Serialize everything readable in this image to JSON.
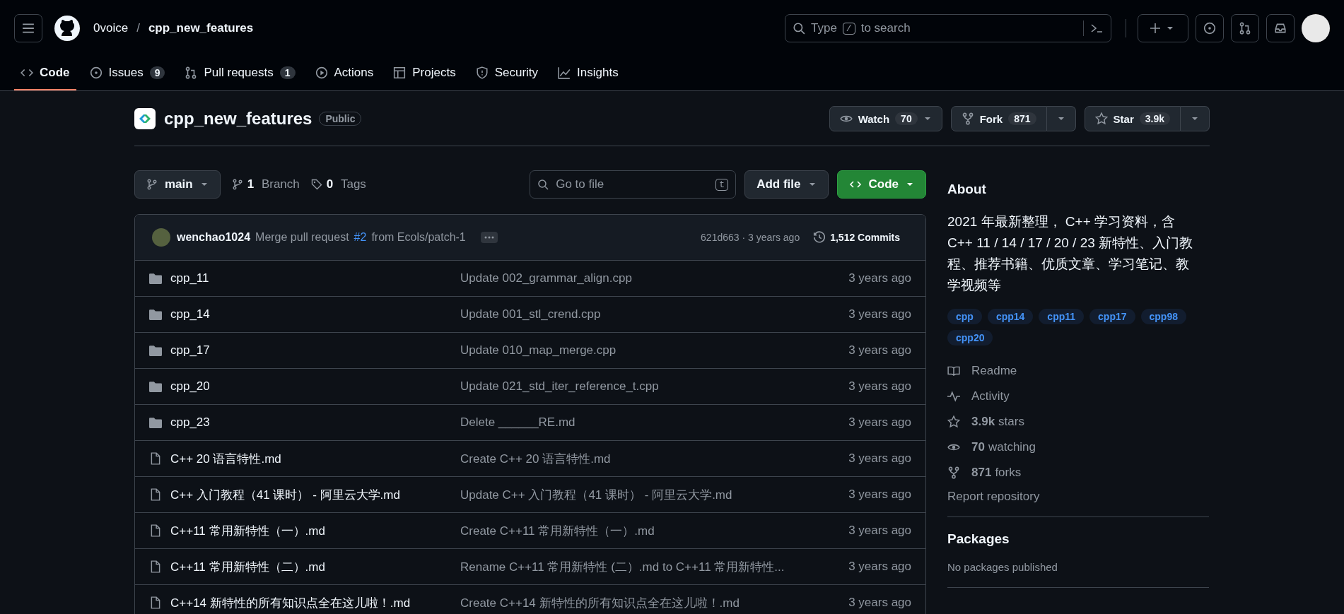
{
  "header": {
    "owner": "0voice",
    "separator": "/",
    "repo": "cpp_new_features",
    "search_placeholder_before": "Type",
    "search_key": "/",
    "search_placeholder_after": "to search"
  },
  "tabs": [
    {
      "label": "Code",
      "kind": "code",
      "selected": true
    },
    {
      "label": "Issues",
      "kind": "issue",
      "counter": "9",
      "selected": false
    },
    {
      "label": "Pull requests",
      "kind": "pr",
      "counter": "1",
      "selected": false
    },
    {
      "label": "Actions",
      "kind": "play",
      "selected": false
    },
    {
      "label": "Projects",
      "kind": "table",
      "selected": false
    },
    {
      "label": "Security",
      "kind": "shield",
      "selected": false
    },
    {
      "label": "Insights",
      "kind": "graph",
      "selected": false
    }
  ],
  "repo": {
    "name": "cpp_new_features",
    "visibility": "Public",
    "watch": {
      "label": "Watch",
      "count": "70"
    },
    "fork": {
      "label": "Fork",
      "count": "871"
    },
    "star": {
      "label": "Star",
      "count": "3.9k"
    }
  },
  "toolbar": {
    "branch": "main",
    "branches_count": "1",
    "branches_label": "Branch",
    "tags_count": "0",
    "tags_label": "Tags",
    "goto_placeholder": "Go to file",
    "goto_key": "t",
    "add_file": "Add file",
    "code": "Code"
  },
  "latest_commit": {
    "author": "wenchao1024",
    "message_before": "Merge pull request",
    "pr_link": "#2",
    "message_after": "from Ecols/patch-1",
    "meta": "621d663 · 3 years ago",
    "commits": "1,512 Commits"
  },
  "files": [
    {
      "kind": "folder",
      "name": "cpp_11",
      "message": "Update 002_grammar_align.cpp",
      "age": "3 years ago"
    },
    {
      "kind": "folder",
      "name": "cpp_14",
      "message": "Update 001_stl_crend.cpp",
      "age": "3 years ago"
    },
    {
      "kind": "folder",
      "name": "cpp_17",
      "message": "Update 010_map_merge.cpp",
      "age": "3 years ago"
    },
    {
      "kind": "folder",
      "name": "cpp_20",
      "message": "Update 021_std_iter_reference_t.cpp",
      "age": "3 years ago"
    },
    {
      "kind": "folder",
      "name": "cpp_23",
      "message": "Delete ______RE.md",
      "age": "3 years ago"
    },
    {
      "kind": "file",
      "name": "C++ 20 语言特性.md",
      "message": "Create C++ 20 语言特性.md",
      "age": "3 years ago"
    },
    {
      "kind": "file",
      "name": "C++ 入门教程（41 课时） - 阿里云大学.md",
      "message": "Update C++ 入门教程（41 课时） - 阿里云大学.md",
      "age": "3 years ago"
    },
    {
      "kind": "file",
      "name": "C++11 常用新特性（一）.md",
      "message": "Create C++11 常用新特性（一）.md",
      "age": "3 years ago"
    },
    {
      "kind": "file",
      "name": "C++11 常用新特性（二）.md",
      "message": "Rename C++11 常用新特性 (二）.md to C++11 常用新特性...",
      "age": "3 years ago"
    },
    {
      "kind": "file",
      "name": "C++14 新特性的所有知识点全在这儿啦！.md",
      "message": "Create C++14 新特性的所有知识点全在这儿啦！.md",
      "age": "3 years ago"
    }
  ],
  "about": {
    "title": "About",
    "description": "2021 年最新整理， C++ 学习资料，含 C++ 11 / 14 / 17 / 20 / 23 新特性、入门教程、推荐书籍、优质文章、学习笔记、教学视频等",
    "topics": [
      "cpp",
      "cpp14",
      "cpp11",
      "cpp17",
      "cpp98",
      "cpp20"
    ],
    "links": [
      {
        "kind": "readme",
        "text": "Readme"
      },
      {
        "kind": "activity",
        "text": "Activity"
      },
      {
        "kind": "star",
        "count": "3.9k",
        "text": "stars"
      },
      {
        "kind": "eye",
        "count": "70",
        "text": "watching"
      },
      {
        "kind": "fork",
        "count": "871",
        "text": "forks"
      }
    ],
    "report": "Report repository"
  },
  "packages": {
    "title": "Packages",
    "empty": "No packages published"
  }
}
